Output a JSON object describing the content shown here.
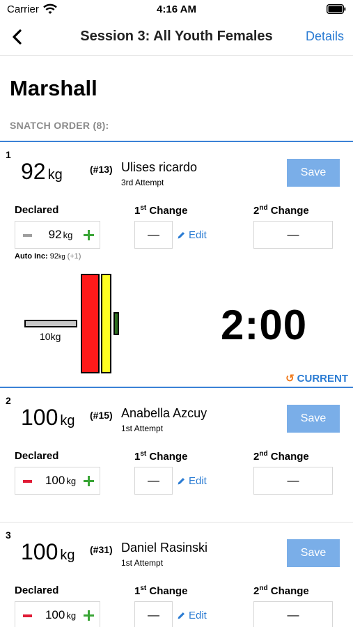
{
  "status_bar": {
    "carrier": "Carrier",
    "time": "4:16 AM"
  },
  "nav": {
    "title": "Session 3: All Youth Females",
    "details": "Details"
  },
  "meet_name": "Marshall",
  "order_label": "SNATCH ORDER (8):",
  "labels": {
    "declared": "Declared",
    "change1": "1",
    "change1_sup": "st",
    "change2": "2",
    "change2_sup": "nd",
    "change_word": " Change",
    "edit": "Edit",
    "save": "Save",
    "empty": "—",
    "unit": "kg"
  },
  "colors": {
    "accent": "#2b7cd3",
    "save_bg": "#7aaee8",
    "plus": "#3aa536",
    "minus_active": "#e01b36",
    "minus_disabled": "#9e9e9e",
    "current_icon": "#f07a1c"
  },
  "lifters": [
    {
      "order": "1",
      "weight": "92",
      "lot": "(#13)",
      "name": "Ulises ricardo",
      "attempt": "3rd Attempt",
      "declared": "92",
      "auto_inc_label": "Auto Inc:",
      "auto_inc_value": "92",
      "auto_inc_unit": "kg",
      "auto_inc_inc": "(+1)",
      "bar_label": "10kg",
      "timer": "2:00",
      "status": "CURRENT"
    },
    {
      "order": "2",
      "weight": "100",
      "lot": "(#15)",
      "name": "Anabella Azcuy",
      "attempt": "1st Attempt",
      "declared": "100"
    },
    {
      "order": "3",
      "weight": "100",
      "lot": "(#31)",
      "name": "Daniel Rasinski",
      "attempt": "1st Attempt",
      "declared": "100"
    }
  ]
}
